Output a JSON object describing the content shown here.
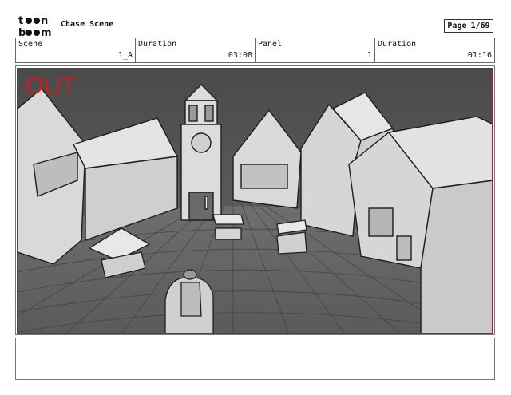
{
  "header": {
    "logo_text_top": "toon",
    "logo_text_bottom": "boom",
    "project_title": "Chase Scene",
    "page_label": "Page",
    "page_value": "1/69"
  },
  "info": {
    "scene_label": "Scene",
    "scene_value": "1_A",
    "scene_duration_label": "Duration",
    "scene_duration_value": "03:08",
    "panel_label": "Panel",
    "panel_value": "1",
    "panel_duration_label": "Duration",
    "panel_duration_value": "01:16"
  },
  "panel": {
    "transition_label": "OUT"
  },
  "colors": {
    "frame_border": "#8a2a2a",
    "transition_text": "#c81e1e"
  }
}
